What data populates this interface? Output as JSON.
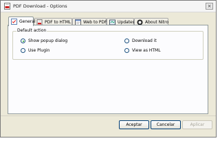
{
  "window": {
    "title": "PDF Download - Options",
    "close_glyph": "×"
  },
  "tabs": [
    {
      "label": "General",
      "icon": "checklist-icon",
      "active": true
    },
    {
      "label": "PDF to HTML",
      "icon": "pdf-document-icon",
      "active": false
    },
    {
      "label": "Web to PDF",
      "icon": "web-page-icon",
      "active": false
    },
    {
      "label": "Updates",
      "icon": "updates-icon",
      "active": false
    },
    {
      "label": "About Nitro",
      "icon": "nitro-logo-icon",
      "active": false
    }
  ],
  "default_action": {
    "label": "Default action",
    "options": [
      {
        "label": "Show popup dialog",
        "selected": true
      },
      {
        "label": "Download it",
        "selected": false
      },
      {
        "label": "Use Plugin",
        "selected": false
      },
      {
        "label": "View as HTML",
        "selected": false
      }
    ]
  },
  "buttons": {
    "accept": "Aceptar",
    "cancel": "Cancelar",
    "apply": "Aplicar",
    "apply_enabled": false
  },
  "colors": {
    "dialog_bg": "#ece9d8",
    "panel_bg": "#fcfcfe",
    "radio_dot": "#21a121",
    "button_border": "#003c74"
  }
}
